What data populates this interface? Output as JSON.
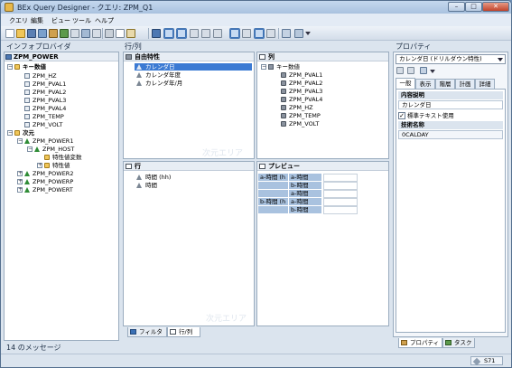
{
  "window": {
    "title": "BEx Query Designer - クエリ: ZPM_Q1",
    "min": "–",
    "max": "□",
    "close": "✕"
  },
  "menu": [
    "クエリ",
    "編集",
    "ビュー",
    "ツール",
    "ヘルプ"
  ],
  "infoprovider": {
    "header": "インフォプロバイダ",
    "provider": "ZPM_POWER",
    "keyfig_folder": "キー数値",
    "keyfigs": [
      "ZPM_HZ",
      "ZPM_PVAL1",
      "ZPM_PVAL2",
      "ZPM_PVAL3",
      "ZPM_PVAL4",
      "ZPM_TEMP",
      "ZPM_VOLT"
    ],
    "dim_folder": "次元",
    "dim1": "ZPM_POWER1",
    "dim1_host": "ZPM_HOST",
    "attr_sub1": "特性値変数",
    "attr_sub2": "特性値",
    "dim2": "ZPM_POWER2",
    "dim3": "ZPM_POWERP",
    "dim4": "ZPM_POWERT"
  },
  "rowcol": {
    "header": "行/列",
    "free_title": "自由特性",
    "free_items": [
      "カレンダ日",
      "カレンダ年度",
      "カレンダ年/月"
    ],
    "col_title": "列",
    "col_folder": "キー数値",
    "col_items": [
      "ZPM_PVAL1",
      "ZPM_PVAL2",
      "ZPM_PVAL3",
      "ZPM_PVAL4",
      "ZPM_HZ",
      "ZPM_TEMP",
      "ZPM_VOLT"
    ],
    "row_title": "行",
    "row_items": [
      "時間 (hh)",
      "時間"
    ],
    "preview_title": "プレビュー",
    "preview": {
      "r1c1": "a-時間 (h",
      "r1c2": "a-時間",
      "r2c2": "b-時間",
      "r3c2": "a-時間",
      "r4c1": "b-時間 (h",
      "r4c2": "a-時間",
      "r5c2": "b-時間"
    },
    "watermark": "次元エリア",
    "tab_filter": "フィルタ",
    "tab_rowcol": "行/列"
  },
  "properties": {
    "header": "プロパティ",
    "dropdown": "カレンダ日 (ドリルダウン特性)",
    "tabs": [
      "一般",
      "表示",
      "階層",
      "計画",
      "詳細"
    ],
    "desc_label": "内容説明",
    "desc_value": "カレンダ日",
    "std_text_checkbox": "標準テキスト使用",
    "check": "✓",
    "tech_label": "技術名称",
    "tech_value": "0CALDAY",
    "bottom_tab1": "プロパティ",
    "bottom_tab2": "タスク"
  },
  "messages": {
    "header": "14 のメッセージ"
  },
  "status": {
    "system": "S71"
  }
}
